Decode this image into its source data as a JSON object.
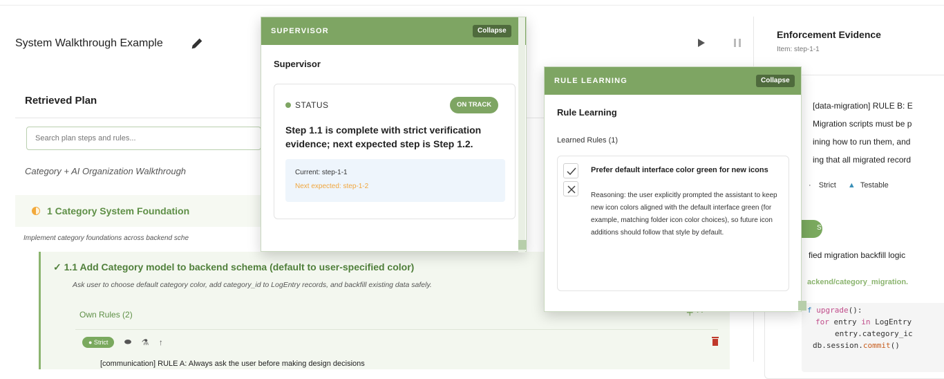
{
  "header": {
    "title": "System Walkthrough Example"
  },
  "plan": {
    "title": "Retrieved Plan",
    "search_placeholder": "Search plan steps and rules...",
    "subtitle": "Category + AI Organization Walkthrough",
    "category": {
      "title": "1 Category System Foundation",
      "description": "Implement category foundations across backend sche"
    },
    "step": {
      "title": "✓ 1.1 Add Category model to backend schema (default to user-specified color)",
      "description": "Ask user to choose default category color, add category_id to LogEntry records, and backfill existing data safely.",
      "own_rules_label": "Own Rules (2)",
      "own_rules_actions": "+ ^",
      "rule_badge": "● Strict",
      "rule_text": "[communication] RULE A: Always ask the user before making design decisions"
    }
  },
  "evidence": {
    "title": "Enforcement Evidence",
    "item": "Item: step-1-1",
    "lines": [
      "[data-migration] RULE B: E",
      "Migration scripts must be p",
      "ining how to run them, and",
      "ing that all migrated record"
    ],
    "tag_strict": "Strict",
    "tag_testable": "Testable",
    "pill_text": "S",
    "verified": "fied migration backfill logic",
    "file": "ackend/category_migration.",
    "code": {
      "line1_kw": "f ",
      "line1_fn": "upgrade",
      "line1_rest": "():",
      "line2_kw": "for",
      "line2_mid": " entry ",
      "line2_kw2": "in",
      "line2_rest": " LogEntry",
      "line3": "entry.category_ic",
      "line4_a": "db.session.",
      "line4_fn": "commit",
      "line4_b": "()"
    }
  },
  "supervisor": {
    "header_label": "SUPERVISOR",
    "collapse_label": "Collapse",
    "title": "Supervisor",
    "status_label": "STATUS",
    "status_badge": "ON TRACK",
    "message": "Step 1.1 is complete with strict verification evidence; next expected step is Step 1.2.",
    "current": "Current: step-1-1",
    "next_expected": "Next expected: step-1-2"
  },
  "rule_learning": {
    "header_label": "RULE LEARNING",
    "collapse_label": "Collapse",
    "title": "Rule Learning",
    "learned_label": "Learned Rules (1)",
    "rule_title": "Prefer default interface color green for new icons",
    "reasoning": "Reasoning: the user explicitly prompted the assistant to keep new icon colors aligned with the default interface green (for example, matching folder icon color choices), so future icon additions should follow that style by default."
  },
  "colors": {
    "accent_green": "#7ea563",
    "dark_green": "#4f6b3d",
    "next_orange": "#f0a63e"
  }
}
